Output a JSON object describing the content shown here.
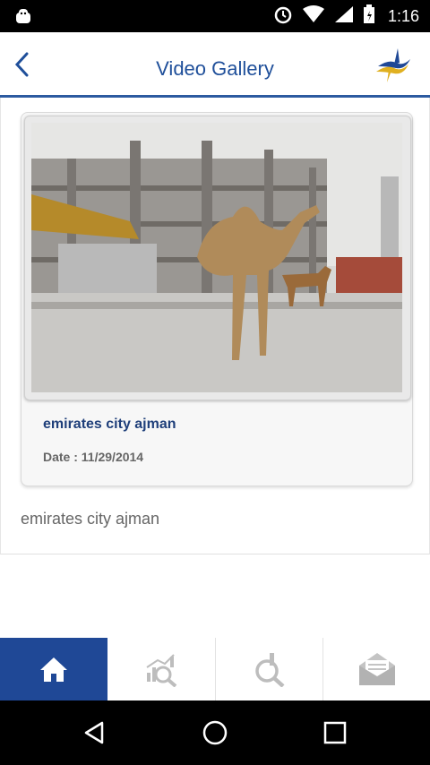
{
  "status_bar": {
    "time": "1:16",
    "icons": [
      "android-icon",
      "alarm-icon",
      "wifi-icon",
      "signal-icon",
      "battery-icon"
    ]
  },
  "header": {
    "title": "Video Gallery",
    "back_icon": "chevron-left-icon",
    "logo": "brand-logo"
  },
  "video_card": {
    "title": "emirates city ajman",
    "date": "Date : 11/29/2014",
    "thumbnail": "video-thumbnail"
  },
  "description": "emirates city ajman",
  "bottom_nav": {
    "items": [
      {
        "icon": "home-icon",
        "active": true
      },
      {
        "icon": "chart-search-icon",
        "active": false
      },
      {
        "icon": "search-icon",
        "active": false
      },
      {
        "icon": "mail-icon",
        "active": false
      }
    ]
  },
  "android_nav": [
    "back-icon",
    "home-circle-icon",
    "recents-icon"
  ],
  "colors": {
    "accent": "#1f4896",
    "title": "#1f4f9a",
    "card_title": "#1f3f7a"
  }
}
